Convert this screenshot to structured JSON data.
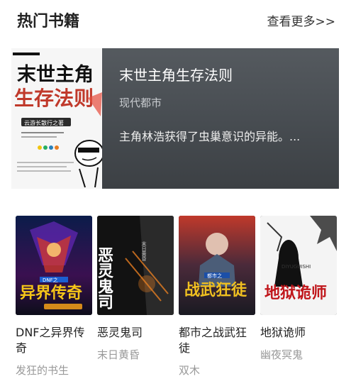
{
  "header": {
    "title": "热门书籍",
    "more_label": "查看更多>>"
  },
  "featured": {
    "title": "末世主角生存法则",
    "genre": "现代都市",
    "description": "主角林浩获得了虫巢意识的异能。...",
    "cover_text": {
      "title_line1": "末世主角",
      "title_line2": "生存法则",
      "author_tag": "云游长散行之著"
    }
  },
  "books": [
    {
      "title": "DNF之异界传奇",
      "author": "发狂的书生",
      "cover_text": "异界传奇",
      "cover_badge": "DNF之"
    },
    {
      "title": "恶灵鬼司",
      "author": "末日黄昏",
      "cover_text": "恶灵鬼司",
      "cover_badge": "末日黄昏"
    },
    {
      "title": "都市之战武狂徒",
      "author": "双木",
      "cover_text": "战武狂徒",
      "cover_badge": "都市之"
    },
    {
      "title": "地狱诡师",
      "author": "幽夜冥鬼",
      "cover_text": "地狱诡师",
      "cover_badge": "DIYUGUISHI"
    }
  ]
}
